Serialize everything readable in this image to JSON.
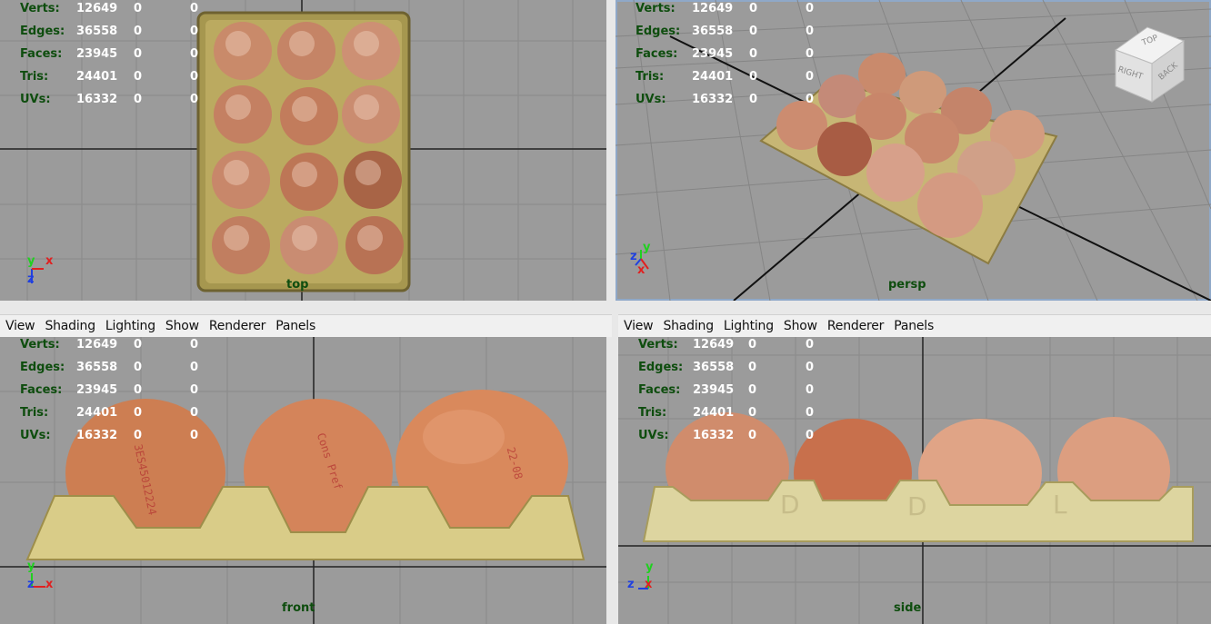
{
  "menu": [
    "View",
    "Shading",
    "Lighting",
    "Show",
    "Renderer",
    "Panels"
  ],
  "hud_stats": [
    {
      "label": "Verts:",
      "a": "12649",
      "b": "0",
      "c": "0"
    },
    {
      "label": "Edges:",
      "a": "36558",
      "b": "0",
      "c": "0"
    },
    {
      "label": "Faces:",
      "a": "23945",
      "b": "0",
      "c": "0"
    },
    {
      "label": "Tris:",
      "a": "24401",
      "b": "0",
      "c": "0"
    },
    {
      "label": "UVs:",
      "a": "16332",
      "b": "0",
      "c": "0"
    }
  ],
  "viewports": {
    "top": {
      "camera": "top"
    },
    "persp": {
      "camera": "persp"
    },
    "front": {
      "camera": "front"
    },
    "side": {
      "camera": "side"
    }
  },
  "view_cube": {
    "top": "TOP",
    "right": "RIGHT",
    "back": "BACK"
  },
  "egg_text": {
    "code": "3ES45012224",
    "brand": "Cons Pref",
    "date": "22-08"
  },
  "tray_marks": {
    "d": "D",
    "l": "L"
  },
  "axis": {
    "x": "x",
    "y": "y",
    "z": "z"
  },
  "colors": {
    "viewport_bg": "#9b9b9b",
    "hud_label": "#0e4d0e",
    "hud_value": "#ffffff",
    "active_border": "#8fa8c8",
    "x_axis": "#e02020",
    "y_axis": "#20d020",
    "z_axis": "#2040e0"
  }
}
